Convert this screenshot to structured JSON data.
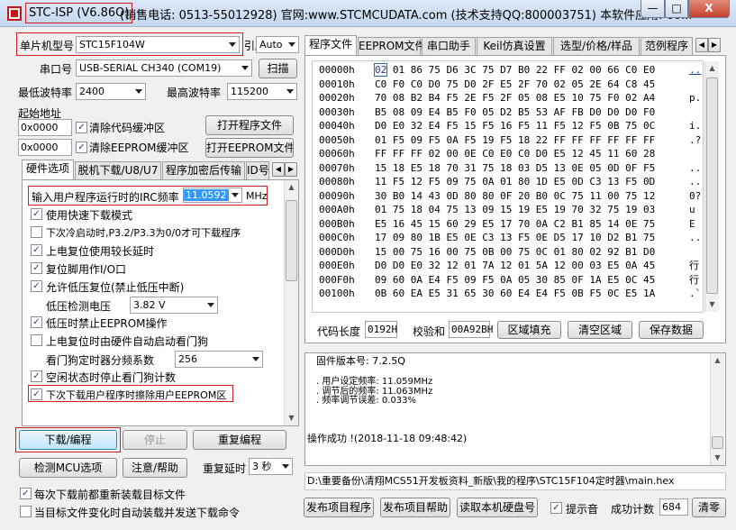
{
  "window": {
    "title_name": "STC-ISP (V6.86O)",
    "title_rest": "(销售电话: 0513-55012928) 官网:www.STCMCUDATA.com  (技术支持QQ:800003751) 本软件应用: 60...",
    "min": "—",
    "max": "□",
    "close": "X"
  },
  "left": {
    "mcu_label": "单片机型号",
    "mcu_value": "STC15F104W",
    "pin_label": "引脚数",
    "pin_value": "Auto",
    "port_label": "串口号",
    "port_value": "USB-SERIAL CH340 (COM19)",
    "scan_button": "扫描",
    "min_baud_label": "最低波特率",
    "min_baud_value": "2400",
    "max_baud_label": "最高波特率",
    "max_baud_value": "115200",
    "start_addr_label": "起始地址",
    "addr1": "0x0000",
    "clear_code_label": "清除代码缓冲区",
    "open_program_button": "打开程序文件",
    "addr2": "0x0000",
    "clear_eeprom_label": "清除EEPROM缓冲区",
    "open_eeprom_button": "打开EEPROM文件",
    "tabs": [
      "硬件选项",
      "脱机下载/U8/U7",
      "程序加密后传输",
      "ID号"
    ],
    "irc_label": "输入用户程序运行时的IRC频率",
    "irc_value": "11.0592",
    "irc_unit": "MHz",
    "options": [
      {
        "label": "使用快速下载模式",
        "checked": true
      },
      {
        "label": "下次冷启动时,P3.2/P3.3为0/0才可下载程序",
        "checked": false
      },
      {
        "label": "上电复位使用较长延时",
        "checked": true
      },
      {
        "label": "复位脚用作I/O口",
        "checked": true
      },
      {
        "label": "允许低压复位(禁止低压中断)",
        "checked": true
      }
    ],
    "lvd_label": "低压检测电压",
    "lvd_value": "3.82 V",
    "options2": [
      {
        "label": "低压时禁止EEPROM操作",
        "checked": true
      },
      {
        "label": "上电复位时由硬件自动启动看门狗",
        "checked": false
      }
    ],
    "wdt_label": "看门狗定时器分频系数",
    "wdt_value": "256",
    "options3": [
      {
        "label": "空闲状态时停止看门狗计数",
        "checked": true
      },
      {
        "label": "下次下载用户程序时擦除用户EEPROM区",
        "checked": true
      }
    ],
    "download_button": "下载/编程",
    "stop_button": "停止",
    "reprogram_button": "重复编程",
    "check_mcu_button": "检测MCU选项",
    "help_button": "注意/帮助",
    "repeat_delay_label": "重复延时",
    "repeat_delay_value": "3 秒",
    "reload_label": "每次下载前都重新装载目标文件",
    "auto_send_label": "当目标文件变化时自动装载并发送下载命令"
  },
  "right": {
    "tabs": [
      "程序文件",
      "EEPROM文件",
      "串口助手",
      "Keil仿真设置",
      "选型/价格/样品",
      "范例程序"
    ],
    "hex_addresses": [
      "00000h",
      "00010h",
      "00020h",
      "00030h",
      "00040h",
      "00050h",
      "00060h",
      "00070h",
      "00080h",
      "00090h",
      "000A0h",
      "000B0h",
      "000C0h",
      "000D0h",
      "000E0h",
      "000F0h",
      "00100h"
    ],
    "hex_rows": [
      "02 01 86 75 D6 3C 75 D7 B0 22 FF 02 00 66 C0 E0",
      "C0 F0 C0 D0 75 D0 2F E5 2F 70 02 05 2E 64 C8 45",
      "70 08 B2 B4 F5 2E F5 2F 05 08 E5 10 75 F0 02 A4",
      "B5 08 09 E4 B5 F0 05 D2 B5 53 AF FB D0 D0 D0 F0",
      "D0 E0 32 E4 F5 15 F5 16 F5 11 F5 12 F5 0B 75 0C",
      "01 F5 09 F5 0A F5 19 F5 18 22 FF FF FF FF FF FF",
      "FF FF FF 02 00 0E C0 E0 C0 D0 E5 12 45 11 60 28",
      "15 18 E5 18 70 31 75 18 03 D5 13 0E 05 0D 0F F5",
      "11 F5 12 F5 09 75 0A 01 80 1D E5 0D C3 13 F5 0D",
      "30 B0 14 43 0D 80 80 0F 20 B0 0C 75 11 00 75 12",
      "01 75 18 04 75 13 09 15 19 E5 19 70 32 75 19 03",
      "E5 16 45 15 60 29 E5 17 70 0A C2 B1 85 14 0E 75",
      "17 09 80 1B E5 0E C3 13 F5 0E D5 17 10 D2 B1 75",
      "15 00 75 16 00 75 0B 00 75 0C 01 80 02 92 B1 D0",
      "D0 D0 E0 32 12 01 7A 12 01 5A 12 00 03 E5 0A 45",
      "09 60 0A E4 F5 09 F5 0A 05 30 85 0F 1A E5 0C 45",
      "0B 60 EA E5 31 65 30 60 E4 E4 F5 0B F5 0C E5 1A"
    ],
    "ascii_rows": [
      "..",
      "",
      "p.",
      "",
      "i.",
      ".?",
      "",
      "..",
      "..",
      "0?",
      "u",
      "E",
      "..",
      "",
      "行",
      "行",
      ".`"
    ],
    "code_len_label": "代码长度",
    "code_len_value": "0192H",
    "checksum_label": "校验和",
    "checksum_value": "00A92BH",
    "fill_button": "区域填充",
    "clear_button": "清空区域",
    "save_button": "保存数据",
    "log_lines": [
      "固件版本号: 7.2.5Q",
      "",
      ". 用户设定频率: 11.059MHz",
      ". 调节后的频率: 11.063MHz",
      ". 频率调节误差: 0.033%",
      "",
      "",
      "",
      "操作成功 !(2018-11-18 09:48:42)"
    ],
    "path": "D:\\重要备份\\清翔MCS51开发板资料_新版\\我的程序\\STC15F104定时器\\main.hex",
    "publish_button": "发布项目程序",
    "publish_help_button": "发布项目帮助",
    "read_hdd_button": "读取本机硬盘号",
    "sound_label": "提示音",
    "success_label": "成功计数",
    "success_value": "684",
    "clear_count_button": "清零"
  },
  "colors": {
    "highlight": "#d21f1f",
    "selection": "#3399ff"
  }
}
